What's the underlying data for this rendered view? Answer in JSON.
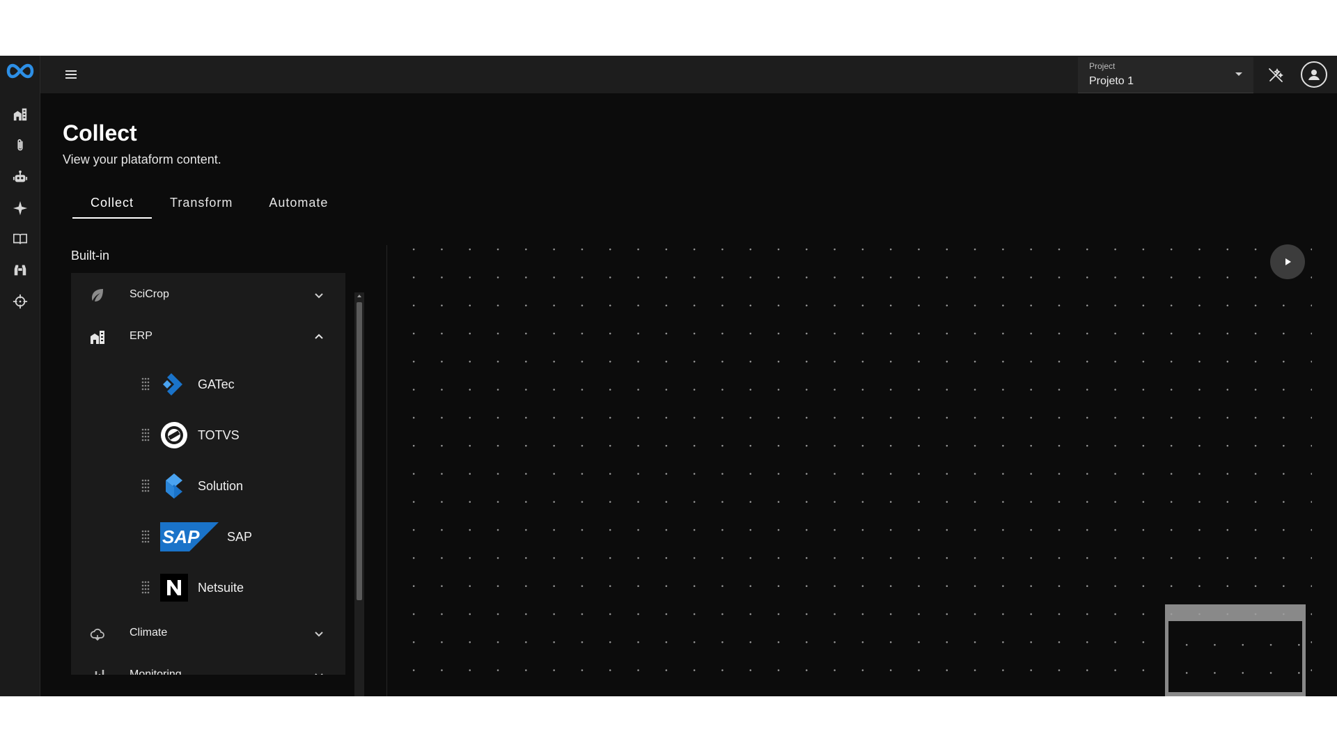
{
  "topbar": {
    "project_label": "Project",
    "project_value": "Projeto 1"
  },
  "rail": {
    "items": [
      "logo-icon",
      "buildings-icon",
      "paperclip-icon",
      "robot-icon",
      "sparkle-icon",
      "book-icon",
      "binoculars-icon",
      "crosshair-icon"
    ]
  },
  "header": {
    "title": "Collect",
    "subtitle": "View your plataform content."
  },
  "tabs": [
    {
      "label": "Collect",
      "active": true
    },
    {
      "label": "Transform",
      "active": false
    },
    {
      "label": "Automate",
      "active": false
    }
  ],
  "catalog": {
    "section_title": "Built-in",
    "groups": [
      {
        "label": "SciCrop",
        "icon": "leaf-icon",
        "expanded": false
      },
      {
        "label": "ERP",
        "icon": "buildings-icon",
        "expanded": true,
        "items": [
          {
            "label": "GATec",
            "logo": "gatec-logo"
          },
          {
            "label": "TOTVS",
            "logo": "totvs-logo"
          },
          {
            "label": "Solution",
            "logo": "solution-logo"
          },
          {
            "label": "SAP",
            "logo": "sap-logo"
          },
          {
            "label": "Netsuite",
            "logo": "netsuite-logo"
          }
        ]
      },
      {
        "label": "Climate",
        "icon": "cloud-sun-icon",
        "expanded": false
      },
      {
        "label": "Monitoring",
        "icon": "chart-icon",
        "expanded": false
      }
    ]
  },
  "colors": {
    "background": "#0c0c0c",
    "panel": "#1b1b1b",
    "topbar": "#1d1d1d",
    "accent_blue": "#1a73c9"
  }
}
